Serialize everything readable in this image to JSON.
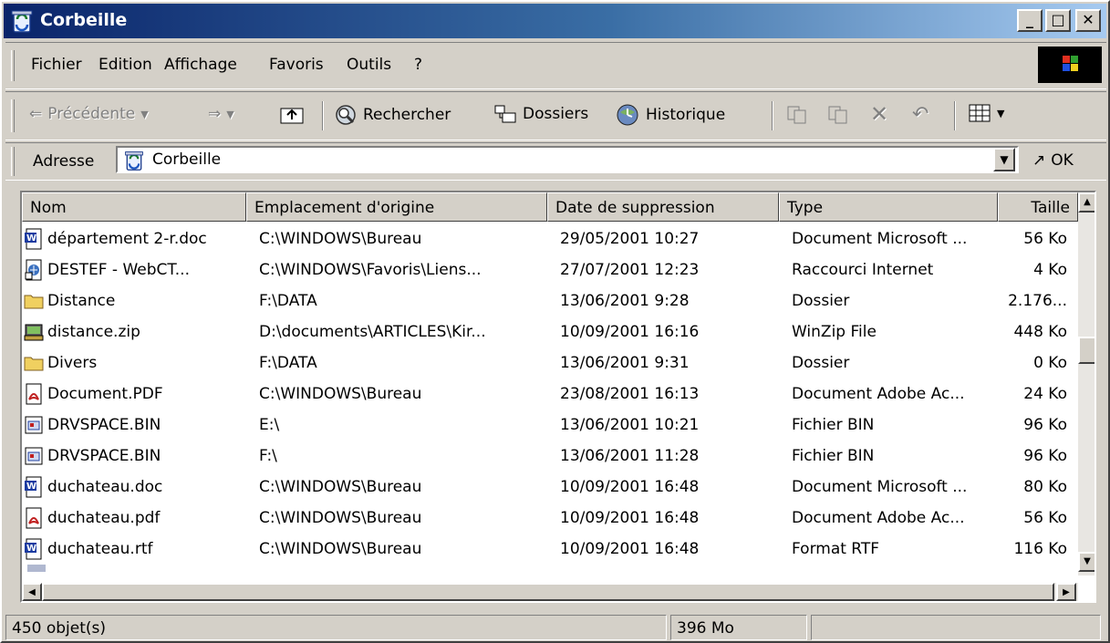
{
  "window": {
    "title": "Corbeille"
  },
  "title_buttons": {
    "minimize": "_",
    "maximize": "□",
    "close": "✕"
  },
  "menu": [
    {
      "label": "Fichier"
    },
    {
      "label": "Edition"
    },
    {
      "label": "Affichage"
    },
    {
      "label": "Favoris"
    },
    {
      "label": "Outils"
    },
    {
      "label": "?"
    }
  ],
  "toolbar": {
    "back": "Précédente",
    "search": "Rechercher",
    "folders": "Dossiers",
    "history": "Historique"
  },
  "address": {
    "label": "Adresse",
    "value": "Corbeille",
    "go": "OK"
  },
  "columns": [
    "Nom",
    "Emplacement d'origine",
    "Date de suppression",
    "Type",
    "Taille"
  ],
  "files": [
    {
      "name": "département 2-r.doc",
      "icon": "word-doc-icon",
      "origin": "C:\\WINDOWS\\Bureau",
      "deleted": "29/05/2001 10:27",
      "type": "Document Microsoft ...",
      "size": "56 Ko"
    },
    {
      "name": "DESTEF - WebCT...",
      "icon": "internet-shortcut-icon",
      "origin": "C:\\WINDOWS\\Favoris\\Liens...",
      "deleted": "27/07/2001 12:23",
      "type": "Raccourci Internet",
      "size": "4 Ko"
    },
    {
      "name": "Distance",
      "icon": "folder-icon",
      "origin": "F:\\DATA",
      "deleted": "13/06/2001 9:28",
      "type": "Dossier",
      "size": "2.176..."
    },
    {
      "name": "distance.zip",
      "icon": "winzip-icon",
      "origin": "D:\\documents\\ARTICLES\\Kir...",
      "deleted": "10/09/2001 16:16",
      "type": "WinZip File",
      "size": "448 Ko"
    },
    {
      "name": "Divers",
      "icon": "folder-icon",
      "origin": "F:\\DATA",
      "deleted": "13/06/2001 9:31",
      "type": "Dossier",
      "size": "0 Ko"
    },
    {
      "name": "Document.PDF",
      "icon": "pdf-icon",
      "origin": "C:\\WINDOWS\\Bureau",
      "deleted": "23/08/2001 16:13",
      "type": "Document Adobe Ac...",
      "size": "24 Ko"
    },
    {
      "name": "DRVSPACE.BIN",
      "icon": "bin-file-icon",
      "origin": "E:\\",
      "deleted": "13/06/2001 10:21",
      "type": "Fichier BIN",
      "size": "96 Ko"
    },
    {
      "name": "DRVSPACE.BIN",
      "icon": "bin-file-icon",
      "origin": "F:\\",
      "deleted": "13/06/2001 11:28",
      "type": "Fichier BIN",
      "size": "96 Ko"
    },
    {
      "name": "duchateau.doc",
      "icon": "word-doc-icon",
      "origin": "C:\\WINDOWS\\Bureau",
      "deleted": "10/09/2001 16:48",
      "type": "Document Microsoft ...",
      "size": "80 Ko"
    },
    {
      "name": "duchateau.pdf",
      "icon": "pdf-icon",
      "origin": "C:\\WINDOWS\\Bureau",
      "deleted": "10/09/2001 16:48",
      "type": "Document Adobe Ac...",
      "size": "56 Ko"
    },
    {
      "name": "duchateau.rtf",
      "icon": "word-doc-icon",
      "origin": "C:\\WINDOWS\\Bureau",
      "deleted": "10/09/2001 16:48",
      "type": "Format RTF",
      "size": "116 Ko"
    }
  ],
  "status": {
    "count": "450 objet(s)",
    "size": "396 Mo"
  },
  "colors": {
    "title_start": "#0a246a",
    "title_end": "#a6caf0",
    "face": "#d4d0c8"
  }
}
